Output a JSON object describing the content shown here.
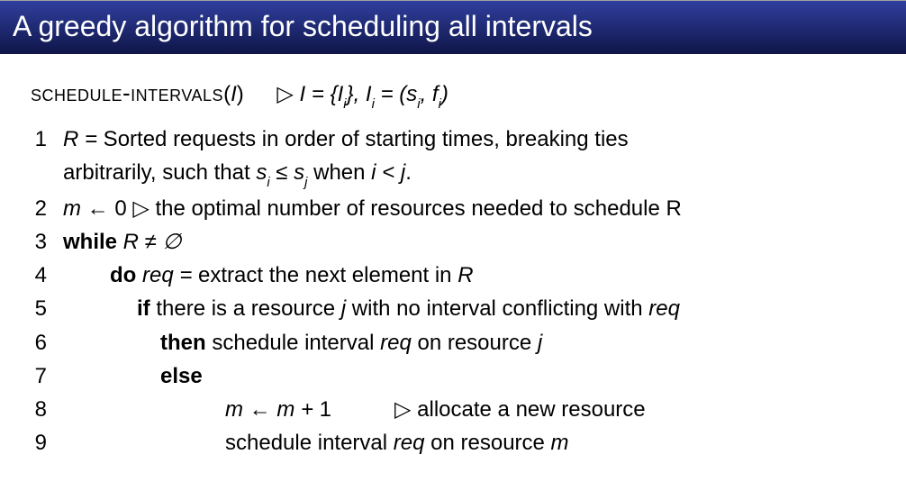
{
  "title": "A greedy algorithm for scheduling all intervals",
  "signature": {
    "name_sc": "schedule-intervals",
    "arg": "I",
    "open": "(",
    "close": ")",
    "tri": "▷",
    "comment_a": " I = {I",
    "comment_b": "}, I",
    "comment_c": " = (s",
    "comment_d": ", f",
    "comment_e": ")",
    "sub_i": "i"
  },
  "lines": {
    "n1": "1",
    "n2": "2",
    "n3": "3",
    "n4": "4",
    "n5": "5",
    "n6": "6",
    "n7": "7",
    "n8": "8",
    "n9": "9",
    "l1a": "R =",
    "l1b": " Sorted requests in order of starting times, breaking ties",
    "l1c": "arbitrarily, such that ",
    "l1d": "s",
    "l1e": " ≤ ",
    "l1f": "s",
    "l1g": " when ",
    "l1h": "i < j",
    "l1i": ".",
    "l2a": "m ← ",
    "l2b": "0",
    "l2c": " ▷ ",
    "l2d": "the optimal number of resources needed to schedule R",
    "l3a": "while",
    "l3b": " R ≠ ∅",
    "l4a": "do",
    "l4b": " req =",
    "l4c": " extract the next element in ",
    "l4d": "R",
    "l5a": "if",
    "l5b": " there is a resource ",
    "l5c": "j",
    "l5d": " with no interval conflicting with ",
    "l5e": "req",
    "l6a": "then",
    "l6b": " schedule interval ",
    "l6c": "req",
    "l6d": " on resource ",
    "l6e": "j",
    "l7a": "else",
    "l8a": "m ← m + ",
    "l8b": "1",
    "l8c": "▷ ",
    "l8d": "allocate a new resource",
    "l9a": "schedule interval ",
    "l9b": "req",
    "l9c": " on resource ",
    "l9d": "m",
    "sub_i": "i",
    "sub_j": "j"
  }
}
